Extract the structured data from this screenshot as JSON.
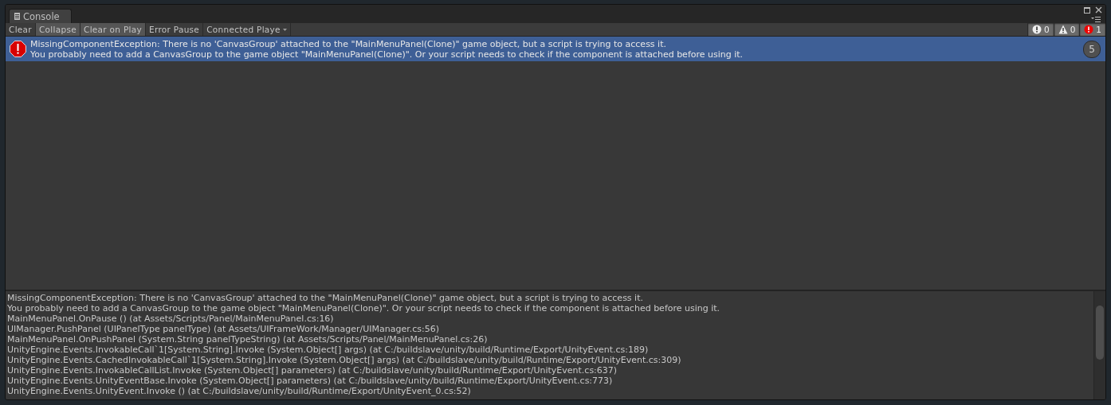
{
  "window": {
    "tab": "Console"
  },
  "toolbar": {
    "buttons": [
      {
        "label": "Clear",
        "selected": false
      },
      {
        "label": "Collapse",
        "selected": true
      },
      {
        "label": "Clear on Play",
        "selected": true
      },
      {
        "label": "Error Pause",
        "selected": false
      }
    ],
    "dropdown": {
      "label": "Connected Playe"
    },
    "counters": [
      {
        "kind": "log",
        "count": "0",
        "selected": true
      },
      {
        "kind": "warning",
        "count": "0",
        "selected": true
      },
      {
        "kind": "error",
        "count": "1",
        "selected": true
      }
    ]
  },
  "entries": [
    {
      "kind": "error",
      "selected": true,
      "count": "5",
      "lines": [
        "MissingComponentException: There is no 'CanvasGroup' attached to the \"MainMenuPanel(Clone)\" game object, but a script is trying to access it.",
        "You probably need to add a CanvasGroup to the game object \"MainMenuPanel(Clone)\". Or your script needs to check if the component is attached before using it."
      ]
    }
  ],
  "detail": {
    "lines": [
      "MissingComponentException: There is no 'CanvasGroup' attached to the \"MainMenuPanel(Clone)\" game object, but a script is trying to access it.",
      "You probably need to add a CanvasGroup to the game object \"MainMenuPanel(Clone)\". Or your script needs to check if the component is attached before using it.",
      "MainMenuPanel.OnPause () (at Assets/Scripts/Panel/MainMenuPanel.cs:16)",
      "UIManager.PushPanel (UIPanelType panelType) (at Assets/UIFrameWork/Manager/UIManager.cs:56)",
      "MainMenuPanel.OnPushPanel (System.String panelTypeString) (at Assets/Scripts/Panel/MainMenuPanel.cs:26)",
      "UnityEngine.Events.InvokableCall`1[System.String].Invoke (System.Object[] args) (at C:/buildslave/unity/build/Runtime/Export/UnityEvent.cs:189)",
      "UnityEngine.Events.CachedInvokableCall`1[System.String].Invoke (System.Object[] args) (at C:/buildslave/unity/build/Runtime/Export/UnityEvent.cs:309)",
      "UnityEngine.Events.InvokableCallList.Invoke (System.Object[] parameters) (at C:/buildslave/unity/build/Runtime/Export/UnityEvent.cs:637)",
      "UnityEngine.Events.UnityEventBase.Invoke (System.Object[] parameters) (at C:/buildslave/unity/build/Runtime/Export/UnityEvent.cs:773)",
      "UnityEngine.Events.UnityEvent.Invoke () (at C:/buildslave/unity/build/Runtime/Export/UnityEvent_0.cs:52)"
    ]
  }
}
